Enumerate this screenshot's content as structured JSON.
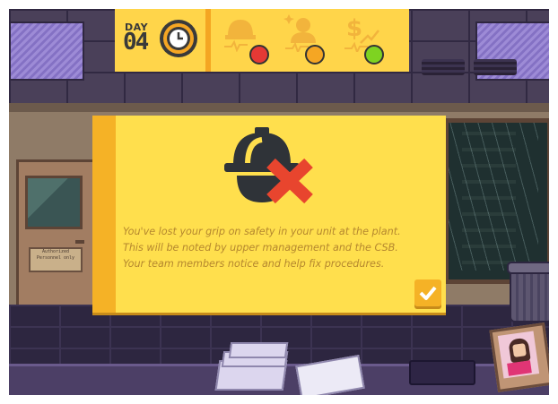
{
  "hud": {
    "day_label": "DAY",
    "day_number": "04",
    "stats": [
      {
        "name": "safety",
        "icon": "hard-hat-icon",
        "mood": "upset",
        "mood_color": "#e53935"
      },
      {
        "name": "team",
        "icon": "team-member-icon",
        "mood": "neutral",
        "mood_color": "#f5a623"
      },
      {
        "name": "budget",
        "icon": "money-growth-icon",
        "mood": "happy",
        "mood_color": "#7ed321"
      }
    ]
  },
  "dialog": {
    "icon": "hard-hat-failed-icon",
    "lines": [
      "You've lost your grip on safety in your unit at the plant.",
      "This will be noted by upper management and the CSB.",
      "Your team members notice and help fix procedures."
    ],
    "confirm_icon": "checkmark-icon"
  },
  "scene": {
    "door_sign": "Authorized Personnel only"
  },
  "colors": {
    "accent": "#ffdf4d",
    "accent_dark": "#f5b226",
    "text": "#b5872e",
    "danger": "#e53935"
  }
}
